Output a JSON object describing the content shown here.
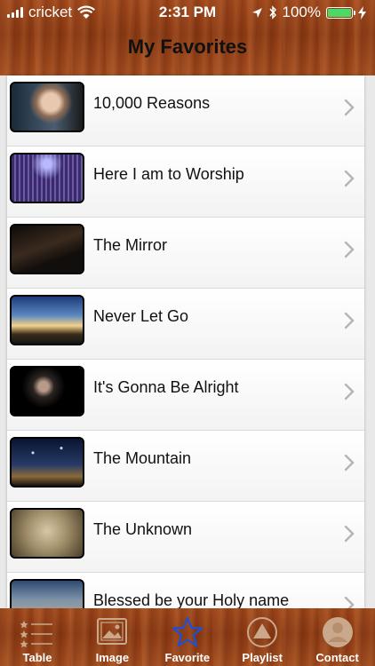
{
  "status_bar": {
    "carrier": "cricket",
    "time": "2:31 PM",
    "battery_percent": "100%"
  },
  "header": {
    "title": "My Favorites"
  },
  "favorites": [
    {
      "title": "10,000 Reasons",
      "thumb": "singer-closeup"
    },
    {
      "title": "Here I am to Worship",
      "thumb": "concert-crowd"
    },
    {
      "title": "The Mirror",
      "thumb": "dark-piano"
    },
    {
      "title": "Never Let Go",
      "thumb": "cross-sunset"
    },
    {
      "title": "It's Gonna Be Alright",
      "thumb": "man-dark-stage"
    },
    {
      "title": "The Mountain",
      "thumb": "starry-sky"
    },
    {
      "title": "The Unknown",
      "thumb": "text-sepia"
    },
    {
      "title": "Blessed be your Holy name",
      "thumb": "lyric-slide"
    }
  ],
  "tabs": [
    {
      "label": "Table",
      "icon": "table-list-icon"
    },
    {
      "label": "Image",
      "icon": "image-icon"
    },
    {
      "label": "Favorite",
      "icon": "star-icon",
      "active": true
    },
    {
      "label": "Playlist",
      "icon": "playlist-triangle-icon"
    },
    {
      "label": "Contact",
      "icon": "person-icon"
    }
  ],
  "colors": {
    "wood": "#9a4318",
    "active_tab": "#1e4fd6",
    "battery": "#4cd964"
  }
}
